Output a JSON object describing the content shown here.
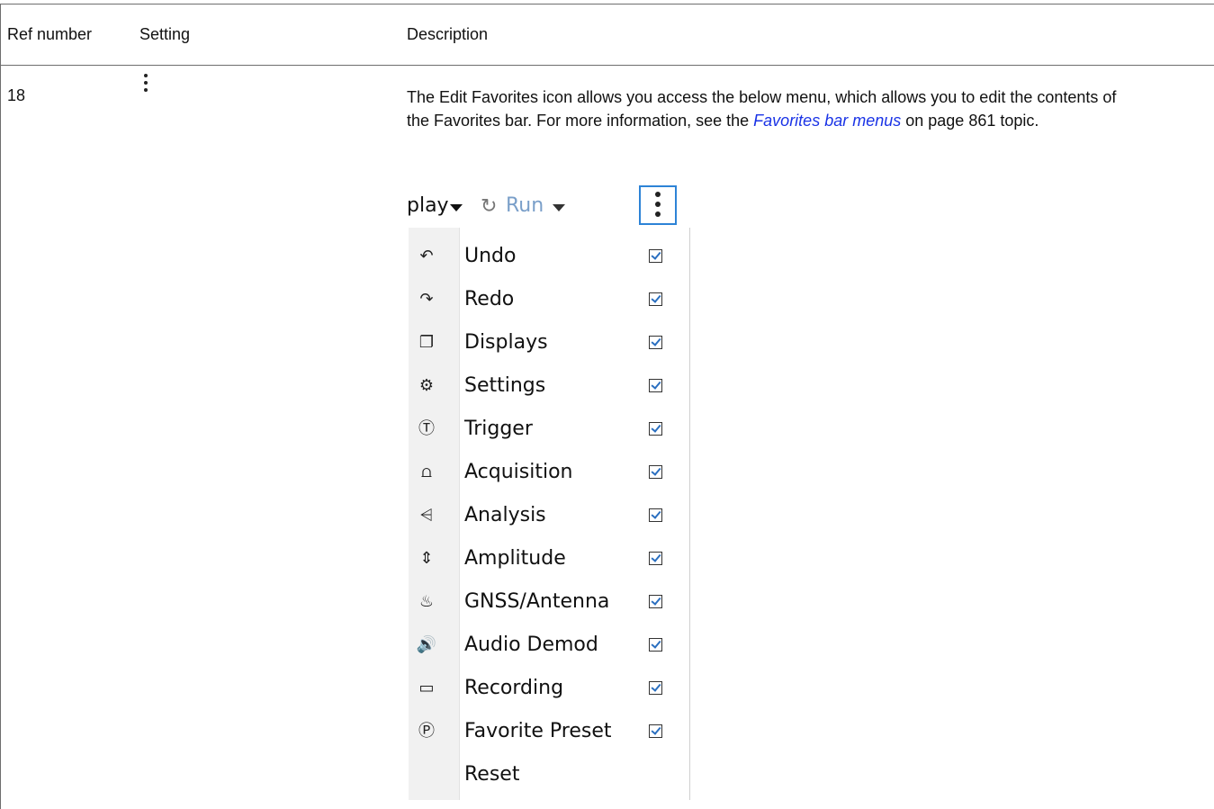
{
  "table": {
    "headers": {
      "ref": "Ref number",
      "setting": "Setting",
      "description": "Description"
    },
    "row": {
      "ref": "18",
      "setting_icon": "kebab-vertical-icon",
      "description": {
        "text_before": "The Edit Favorites icon allows you access the below menu, which allows you to edit the contents of the Favorites bar. For more information, see the ",
        "link_text": "Favorites bar menus",
        "text_after": " on page 861 topic."
      }
    }
  },
  "screenshot": {
    "toolbar": {
      "display_label": "play",
      "run_label": "Run",
      "more_icon": "kebab-vertical-icon"
    },
    "menu_items": [
      {
        "label": "Undo",
        "icon": "undo-icon",
        "glyph": "↶",
        "checked": true
      },
      {
        "label": "Redo",
        "icon": "redo-icon",
        "glyph": "↷",
        "checked": true
      },
      {
        "label": "Displays",
        "icon": "displays-icon",
        "glyph": "❐",
        "checked": true
      },
      {
        "label": "Settings",
        "icon": "gear-icon",
        "glyph": "⚙",
        "checked": true
      },
      {
        "label": "Trigger",
        "icon": "trigger-icon",
        "glyph": "Ⓣ",
        "checked": true
      },
      {
        "label": "Acquisition",
        "icon": "acquisition-icon",
        "glyph": "⩍",
        "checked": true
      },
      {
        "label": "Analysis",
        "icon": "analysis-icon",
        "glyph": "⩤",
        "checked": true
      },
      {
        "label": "Amplitude",
        "icon": "amplitude-icon",
        "glyph": "⇕",
        "checked": true
      },
      {
        "label": "GNSS/Antenna",
        "icon": "antenna-icon",
        "glyph": "♨",
        "checked": true
      },
      {
        "label": "Audio Demod",
        "icon": "speaker-icon",
        "glyph": "🔊",
        "checked": true
      },
      {
        "label": "Recording",
        "icon": "camera-icon",
        "glyph": "▭",
        "checked": true
      },
      {
        "label": "Favorite Preset",
        "icon": "preset-icon",
        "glyph": "Ⓟ",
        "checked": true
      },
      {
        "label": "Reset",
        "icon": "",
        "glyph": "",
        "checked": false
      }
    ]
  },
  "colors": {
    "link": "#1a33e6",
    "rule": "#6e6e6e",
    "menu_focus": "#2d83d6",
    "run_text": "#7a9fc9"
  }
}
